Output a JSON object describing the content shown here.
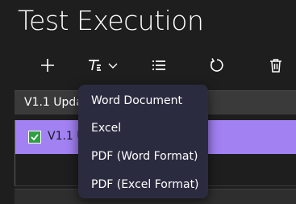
{
  "page": {
    "title": "Test Execution"
  },
  "toolbar": {
    "buttons": [
      {
        "name": "add",
        "icon": "plus-icon"
      },
      {
        "name": "export",
        "icon": "text-format-icon",
        "dropdown_icon": "chevron-down-icon"
      },
      {
        "name": "list",
        "icon": "list-icon"
      },
      {
        "name": "refresh",
        "icon": "refresh-icon"
      },
      {
        "name": "delete",
        "icon": "trash-icon"
      }
    ]
  },
  "table": {
    "header_label": "V1.1 Upda",
    "rows": [
      {
        "label": "V1.1 U",
        "checked": true,
        "selected": true
      }
    ]
  },
  "export_menu": {
    "items": [
      "Word Document",
      "Excel",
      "PDF (Word Format)",
      "PDF (Excel Format)"
    ]
  },
  "colors": {
    "background": "#1e1e1e",
    "selected_row": "#a281f3",
    "menu_background": "#2b2b40",
    "check": "#2ea043",
    "header_row": "#3a3a3a"
  }
}
